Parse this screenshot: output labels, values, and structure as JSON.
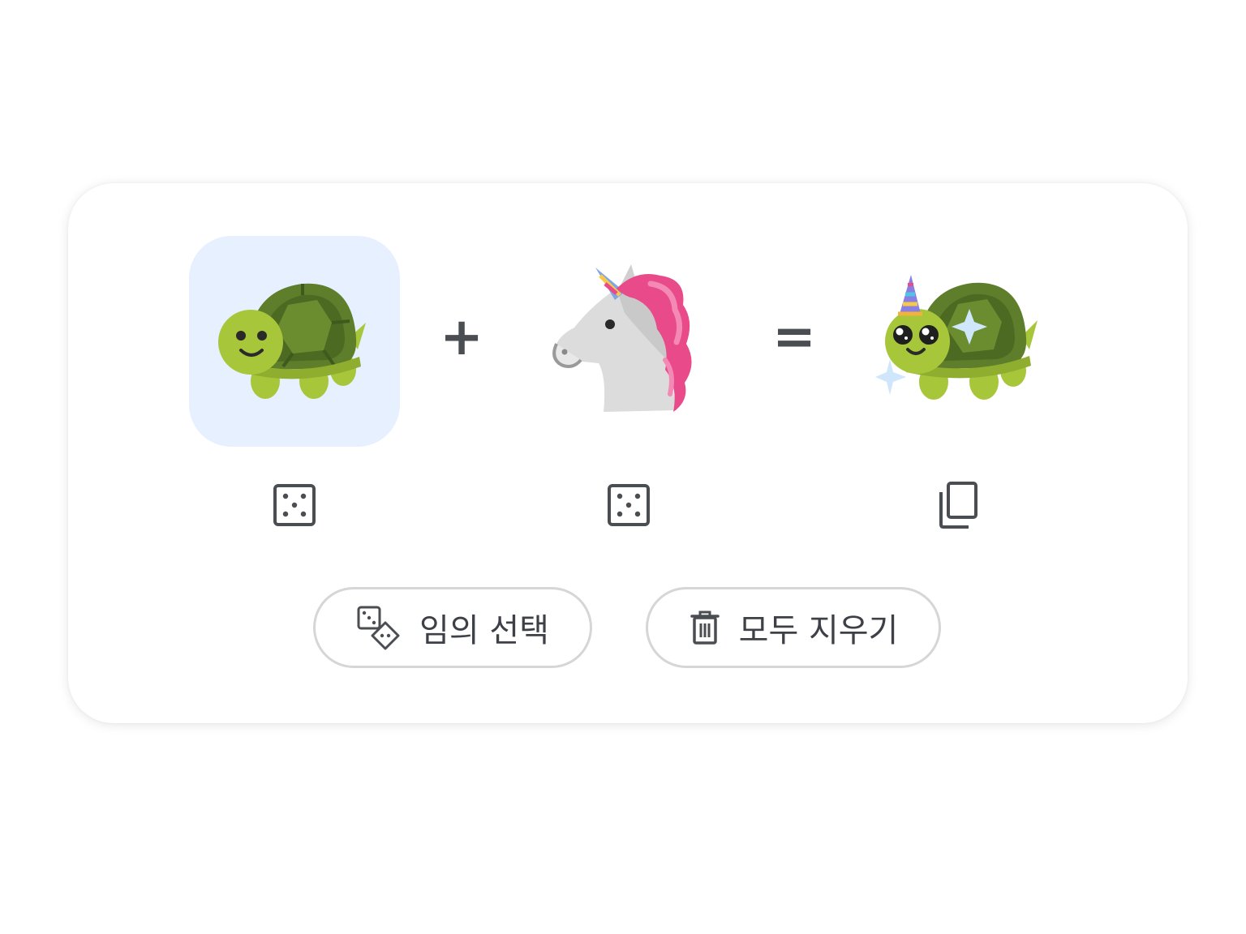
{
  "mixer": {
    "operator_plus": "+",
    "operator_equals": "=",
    "left_emoji": {
      "name": "turtle-emoji",
      "selected": true
    },
    "right_emoji": {
      "name": "unicorn-emoji",
      "selected": false
    },
    "result_emoji": {
      "name": "unicorn-turtle-emoji"
    }
  },
  "controls": {
    "left_random_icon": "dice-icon",
    "right_random_icon": "dice-icon",
    "result_copy_icon": "copy-icon"
  },
  "actions": {
    "randomize_label": "임의 선택",
    "randomize_icon": "dice-pair-icon",
    "clear_label": "모두 지우기",
    "clear_icon": "trash-icon"
  },
  "colors": {
    "selected_slot_bg": "#e6f0fe",
    "icon_color": "#4a4d52",
    "pill_border": "#d6d6d6"
  }
}
